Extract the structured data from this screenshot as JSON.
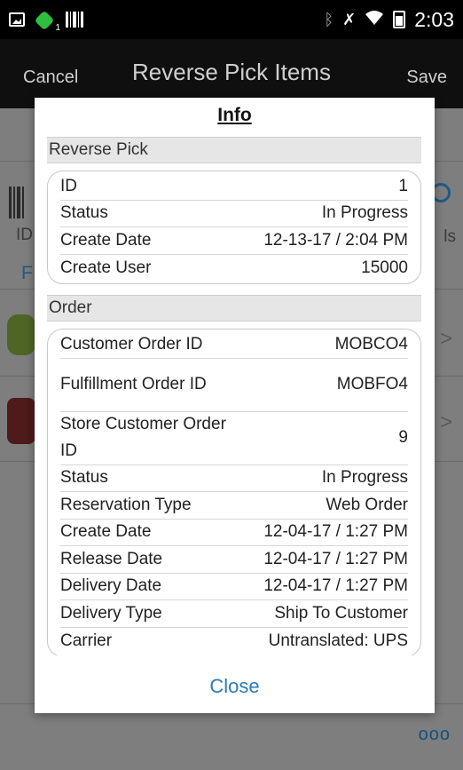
{
  "status_bar": {
    "time": "2:03",
    "icons": [
      "image-icon",
      "android-icon",
      "barcode-icon",
      "bluetooth-icon",
      "mute-icon",
      "wifi-icon",
      "battery-icon"
    ],
    "android_badge": "1"
  },
  "action_bar": {
    "cancel_label": "Cancel",
    "title": "Reverse Pick Items",
    "save_label": "Save"
  },
  "background": {
    "left_id_fragment": "ID",
    "right_fragment": "ls",
    "blue_letter": "F",
    "more_label": "ooo"
  },
  "dialog": {
    "title": "Info",
    "sections": [
      {
        "header": "Reverse Pick",
        "rows": [
          {
            "label": "ID",
            "value": "1"
          },
          {
            "label": "Status",
            "value": "In Progress"
          },
          {
            "label": "Create Date",
            "value": "12-13-17 / 2:04 PM"
          },
          {
            "label": "Create User",
            "value": "15000"
          }
        ]
      },
      {
        "header": "Order",
        "rows": [
          {
            "label": "Customer Order ID",
            "value": "MOBCO4"
          },
          {
            "label": "Fulfillment Order ID",
            "value": "MOBFO4"
          },
          {
            "label": "Store Customer Order ID",
            "value": "9"
          },
          {
            "label": "Status",
            "value": "In Progress"
          },
          {
            "label": "Reservation Type",
            "value": "Web Order"
          },
          {
            "label": "Create Date",
            "value": "12-04-17 / 1:27 PM"
          },
          {
            "label": "Release Date",
            "value": "12-04-17 / 1:27 PM"
          },
          {
            "label": "Delivery Date",
            "value": "12-04-17 / 1:27 PM"
          },
          {
            "label": "Delivery Type",
            "value": "Ship To Customer"
          },
          {
            "label": "Carrier",
            "value": "Untranslated: UPS"
          }
        ]
      }
    ],
    "close_label": "Close"
  }
}
